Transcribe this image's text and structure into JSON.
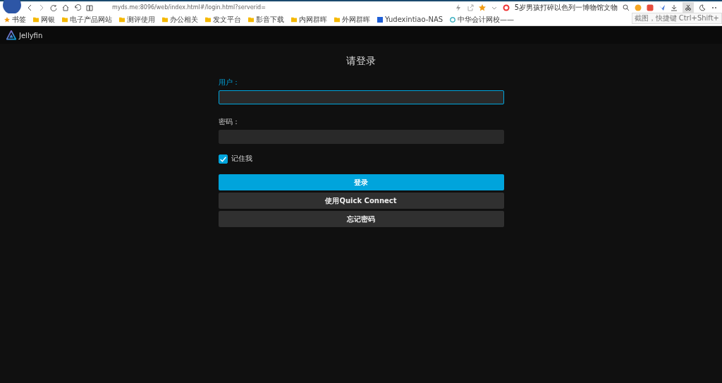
{
  "browser": {
    "url": "myds.me:8096/web/index.html#/login.html?serverid=",
    "search_text": "5岁男孩打碎以色列一博物馆文物",
    "tooltip": "截图，快捷键 Ctrl+Shift+",
    "bookmarks": [
      {
        "label": "书签",
        "kind": "star"
      },
      {
        "label": "网银",
        "kind": "folder"
      },
      {
        "label": "电子产品网站",
        "kind": "folder"
      },
      {
        "label": "测评使用",
        "kind": "folder"
      },
      {
        "label": "办公相关",
        "kind": "folder"
      },
      {
        "label": "发文平台",
        "kind": "folder"
      },
      {
        "label": "影音下载",
        "kind": "folder"
      },
      {
        "label": "内网群晖",
        "kind": "folder"
      },
      {
        "label": "外网群晖",
        "kind": "folder"
      },
      {
        "label": "Yudexintiao-NAS",
        "kind": "site"
      },
      {
        "label": "中华会计网校——",
        "kind": "site2"
      }
    ]
  },
  "app": {
    "name": "Jellyfin"
  },
  "login": {
    "title": "请登录",
    "fields": [
      {
        "label": "用户：",
        "focused": true
      },
      {
        "label": "密码：",
        "focused": false
      }
    ],
    "remember": {
      "label": "记住我",
      "checked": true
    },
    "buttons": [
      {
        "label": "登录",
        "primary": true
      },
      {
        "label": "使用Quick Connect",
        "primary": false
      },
      {
        "label": "忘记密码",
        "primary": false
      }
    ]
  }
}
